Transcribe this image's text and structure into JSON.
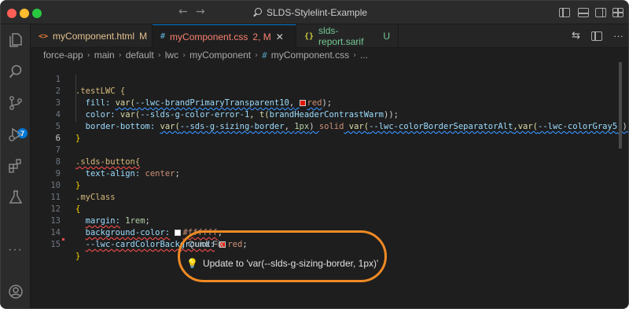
{
  "window": {
    "title": "SLDS-Stylelint-Example"
  },
  "tabs": [
    {
      "label": "myComponent.html",
      "icon": "<>",
      "status": "M",
      "icon_color": "#e37933"
    },
    {
      "label": "myComponent.css",
      "icon": "#",
      "status": "2, M",
      "icon_color": "#519aba",
      "active": true
    },
    {
      "label": "slds-report.sarif",
      "icon": "{}",
      "status": "U",
      "icon_color": "#cbcb41"
    }
  ],
  "breadcrumb": [
    "force-app",
    "main",
    "default",
    "lwc",
    "myComponent",
    "myComponent.css",
    "..."
  ],
  "activity_badge": "7",
  "code": {
    "line_numbers": [
      "1",
      "2",
      "3",
      "4",
      "5",
      "6",
      "7",
      "8",
      "9",
      "10",
      "11",
      "12",
      "13",
      "14",
      "15"
    ],
    "l1": ".testLWC {",
    "l2_prop": "fill:",
    "l2_fn": "var(",
    "l2_var": "--lwc-brandPrimaryTransparent10",
    "l2_sep": ",",
    "l2_val": "red",
    "l2_end": ");",
    "l3_prop": "color:",
    "l3_fn": "var(",
    "l3_var": "--slds-g-color-error-1",
    "l3_mid": ", t(",
    "l3_arg": "brandHeaderContrastWarm",
    "l3_end": "));",
    "l4_prop": "border-bottom:",
    "l4_fn": "var(",
    "l4_var": "--sds-g-sizing-border",
    "l4_sep": ", ",
    "l4_num": "1px",
    "l4_close": ") ",
    "l4_solid": "solid",
    "l4_fn2": " var(",
    "l4_var2": "--lwc-colorBorderSeparatorAlt",
    "l4_fn3": ",var(",
    "l4_var3": "--lwc-colorGray5",
    "l4_end": "));",
    "l5": "}",
    "l7": ".slds-button{",
    "l8_prop": "text-align:",
    "l8_val": "center",
    "l8_end": ";",
    "l9": "}",
    "l10": ".myClass",
    "l11": "{",
    "l12_prop": "margin:",
    "l12_num": "1rem",
    "l12_end": ";",
    "l13_prop": "background-color:",
    "l13_val": "#ffffff",
    "l13_end": ";",
    "l14_prop": "--lwc-cardColorBackground:",
    "l14_val": "red",
    "l14_end": ";",
    "l15": "}"
  },
  "swatches": {
    "red": "#e51400",
    "white": "#ffffff"
  },
  "quick_fix": {
    "title": "Quick Fix",
    "item": "Update to 'var(--slds-g-sizing-border, 1px)'"
  }
}
